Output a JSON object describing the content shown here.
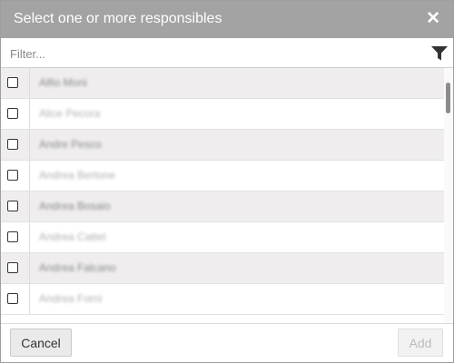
{
  "dialog": {
    "title": "Select one or more responsibles",
    "close_glyph": "✕",
    "filter_placeholder": "Filter...",
    "cancel_label": "Cancel",
    "add_label": "Add",
    "filter_icon": "funnel-icon"
  },
  "people": [
    {
      "name": "Alfio Moni",
      "checked": false
    },
    {
      "name": "Alice Pecora",
      "checked": false
    },
    {
      "name": "Andre Pesco",
      "checked": false
    },
    {
      "name": "Andrea Bertone",
      "checked": false
    },
    {
      "name": "Andrea Bosaio",
      "checked": false
    },
    {
      "name": "Andrea Cattel",
      "checked": false
    },
    {
      "name": "Andrea Falcano",
      "checked": false
    },
    {
      "name": "Andrea Forni",
      "checked": false
    }
  ],
  "colors": {
    "titlebar": "#a3a3a3",
    "row_alt": "#efedee"
  }
}
